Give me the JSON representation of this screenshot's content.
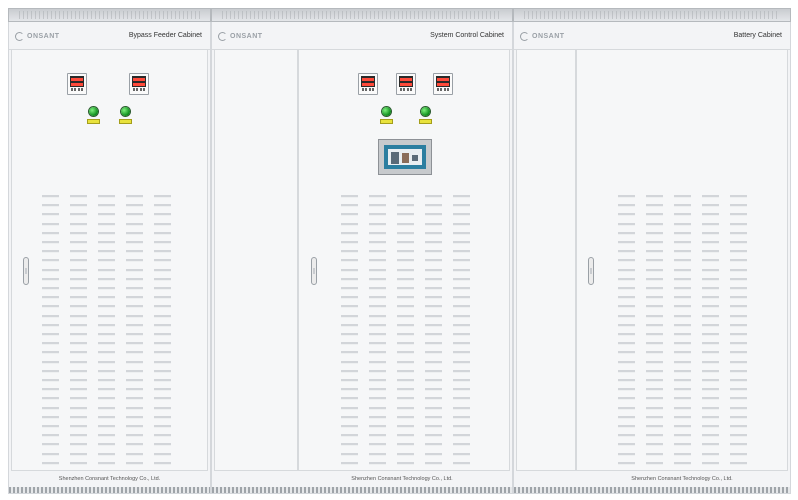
{
  "cabinets": [
    {
      "title": "Bypass Feeder Cabinet",
      "logo": "ONSANT",
      "footer": "Shenzhen Consnant Technology Co., Ltd."
    },
    {
      "title": "System Control Cabinet",
      "logo": "ONSANT",
      "footer": "Shenzhen Consnant Technology Co., Ltd."
    },
    {
      "title": "Battery Cabinet",
      "logo": "ONSANT",
      "footer": "Shenzhen Consnant Technology Co., Ltd."
    }
  ],
  "colors": {
    "body": "#f3f4f6",
    "indicator": "#1db83a",
    "label_plate": "#e8e23c",
    "screen": "#2b7ea0",
    "display_digits": "#ff4a3a"
  },
  "icons": [
    "company-logo-icon",
    "digital-meter-icon",
    "indicator-lamp-icon",
    "door-handle-icon",
    "touch-screen-icon"
  ]
}
